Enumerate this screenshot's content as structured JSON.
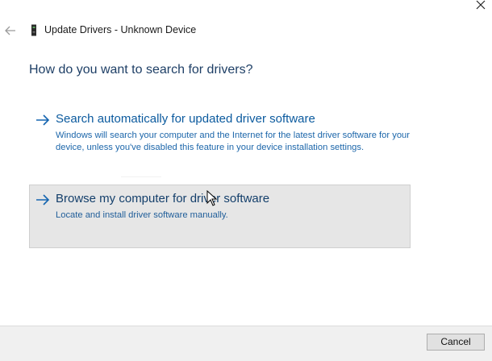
{
  "window": {
    "title": "Update Drivers - Unknown Device",
    "icons": {
      "back": "back-arrow-icon",
      "device": "device-icon",
      "close": "close-icon"
    }
  },
  "main": {
    "question": "How do you want to search for drivers?",
    "options": [
      {
        "heading": "Search automatically for updated driver software",
        "description": "Windows will search your computer and the Internet for the latest driver software for your device, unless you've disabled this feature in your device installation settings.",
        "icon": "right-arrow-icon"
      },
      {
        "heading": "Browse my computer for driver software",
        "description": "Locate and install driver software manually.",
        "icon": "right-arrow-icon",
        "state": "hovered"
      }
    ]
  },
  "footer": {
    "cancel_label": "Cancel"
  },
  "colors": {
    "heading": "#0b5a9e",
    "question": "#1e3f66",
    "hover_bg": "#e6e6e6",
    "footer_bg": "#f0f0f0"
  }
}
